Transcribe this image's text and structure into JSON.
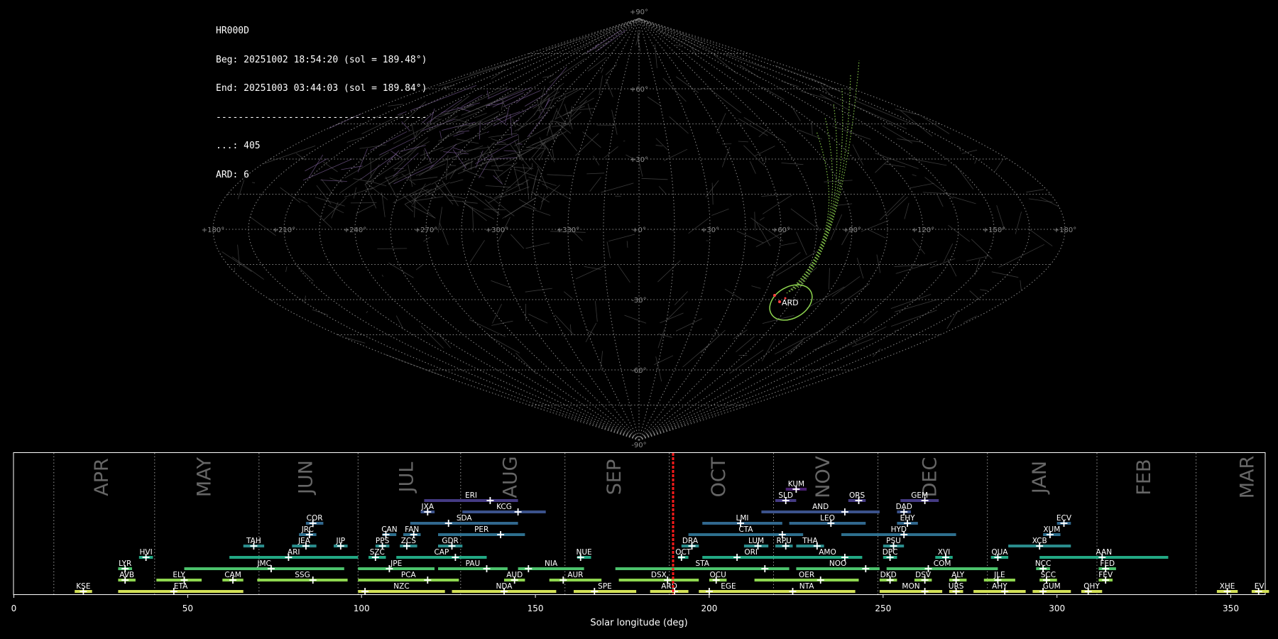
{
  "header": {
    "station": "HR000D",
    "begin": "Beg: 20251002 18:54:20 (sol = 189.48°)",
    "end": "End: 20251003 03:44:03 (sol = 189.84°)",
    "separator": "--------------------------------------",
    "count_line": "...: 405",
    "ard_line": "ARD: 6"
  },
  "chart_data": [
    {
      "type": "scatter",
      "projection": "sinusoidal sky map (radiant positions)",
      "lon_tick_labels": [
        "+180°",
        "+150°",
        "+120°",
        "+90°",
        "+60°",
        "+30°",
        "+0°",
        "+330°",
        "+300°",
        "+270°",
        "+240°",
        "+210°",
        "+180°"
      ],
      "lat_tick_labels": [
        "+90°",
        "+60°",
        "+30°",
        "-30°",
        "-60°",
        "-90°"
      ],
      "highlight": {
        "label": "ARD",
        "color": "#8ed64f"
      },
      "grid": true
    },
    {
      "type": "timeline",
      "xlabel": "Solar longitude (deg)",
      "xlim": [
        0,
        360
      ],
      "x_ticks": [
        0,
        50,
        100,
        150,
        200,
        250,
        300,
        350
      ],
      "current_sol": 189.6,
      "months": [
        {
          "name": "APR",
          "start": 11.5,
          "end": 40.5
        },
        {
          "name": "MAY",
          "start": 40.5,
          "end": 70.5
        },
        {
          "name": "JUN",
          "start": 70.5,
          "end": 99
        },
        {
          "name": "JUL",
          "start": 99,
          "end": 128.5
        },
        {
          "name": "AUG",
          "start": 128.5,
          "end": 158.5
        },
        {
          "name": "SEP",
          "start": 158.5,
          "end": 188.5
        },
        {
          "name": "OCT",
          "start": 188.5,
          "end": 218.5
        },
        {
          "name": "NOV",
          "start": 218.5,
          "end": 248.5
        },
        {
          "name": "DEC",
          "start": 248.5,
          "end": 280
        },
        {
          "name": "JAN",
          "start": 280,
          "end": 311.5
        },
        {
          "name": "FEB",
          "start": 311.5,
          "end": 340
        },
        {
          "name": "MAR",
          "start": 340,
          "end": 371
        }
      ],
      "showers": [
        {
          "code": "KSE",
          "row": 0,
          "start": 17.5,
          "end": 22.5,
          "peak": 20,
          "color": "#d4e157"
        },
        {
          "code": "ETA",
          "row": 0,
          "start": 30,
          "end": 66,
          "peak": 46,
          "color": "#d4e157"
        },
        {
          "code": "NZC",
          "row": 0,
          "start": 99,
          "end": 124,
          "peak": 101,
          "color": "#d4e157"
        },
        {
          "code": "NDA",
          "row": 0,
          "start": 126,
          "end": 156,
          "peak": 141,
          "color": "#d4e157"
        },
        {
          "code": "SPE",
          "row": 0,
          "start": 161,
          "end": 179,
          "peak": 167,
          "color": "#d4e157"
        },
        {
          "code": "ARD",
          "row": 0,
          "start": 183,
          "end": 194,
          "peak": 190,
          "color": "#d4e157"
        },
        {
          "code": "EGE",
          "row": 0,
          "start": 197,
          "end": 214,
          "peak": 200,
          "color": "#d4e157"
        },
        {
          "code": "NTA",
          "row": 0,
          "start": 214,
          "end": 242,
          "peak": 224,
          "color": "#d4e157"
        },
        {
          "code": "MON",
          "row": 0,
          "start": 249,
          "end": 267,
          "peak": 262,
          "color": "#d4e157"
        },
        {
          "code": "URS",
          "row": 0,
          "start": 269,
          "end": 273,
          "peak": 271,
          "color": "#d4e157"
        },
        {
          "code": "AHY",
          "row": 0,
          "start": 276,
          "end": 291,
          "peak": 285,
          "color": "#d4e157"
        },
        {
          "code": "GUM",
          "row": 0,
          "start": 293,
          "end": 304,
          "peak": 296,
          "color": "#d4e157"
        },
        {
          "code": "OHY",
          "row": 0,
          "start": 307,
          "end": 313,
          "peak": 309,
          "color": "#d4e157"
        },
        {
          "code": "XHE",
          "row": 0,
          "start": 346,
          "end": 352,
          "peak": 349,
          "color": "#d4e157"
        },
        {
          "code": "EVI",
          "row": 0,
          "start": 356,
          "end": 361,
          "peak": 358,
          "color": "#d4e157"
        },
        {
          "code": "AVB",
          "row": 1,
          "start": 30,
          "end": 35,
          "peak": 32,
          "color": "#8ed64f"
        },
        {
          "code": "ELY",
          "row": 1,
          "start": 41,
          "end": 54,
          "peak": 49,
          "color": "#8ed64f"
        },
        {
          "code": "CAM",
          "row": 1,
          "start": 60,
          "end": 66,
          "peak": 63,
          "color": "#8ed64f"
        },
        {
          "code": "SSG",
          "row": 1,
          "start": 70,
          "end": 96,
          "peak": 86,
          "color": "#8ed64f"
        },
        {
          "code": "PCA",
          "row": 1,
          "start": 99,
          "end": 128,
          "peak": 119,
          "color": "#8ed64f"
        },
        {
          "code": "AUD",
          "row": 1,
          "start": 141,
          "end": 147,
          "peak": 144,
          "color": "#8ed64f"
        },
        {
          "code": "AUR",
          "row": 1,
          "start": 154,
          "end": 169,
          "peak": 158,
          "color": "#8ed64f"
        },
        {
          "code": "DSX",
          "row": 1,
          "start": 174,
          "end": 197,
          "peak": 188,
          "color": "#8ed64f"
        },
        {
          "code": "OCU",
          "row": 1,
          "start": 200,
          "end": 205,
          "peak": 202,
          "color": "#8ed64f"
        },
        {
          "code": "OER",
          "row": 1,
          "start": 213,
          "end": 243,
          "peak": 232,
          "color": "#8ed64f"
        },
        {
          "code": "DKD",
          "row": 1,
          "start": 249,
          "end": 254,
          "peak": 252,
          "color": "#8ed64f"
        },
        {
          "code": "DSV",
          "row": 1,
          "start": 259,
          "end": 264,
          "peak": 262,
          "color": "#8ed64f"
        },
        {
          "code": "ALY",
          "row": 1,
          "start": 269,
          "end": 274,
          "peak": 271,
          "color": "#8ed64f"
        },
        {
          "code": "JLE",
          "row": 1,
          "start": 279,
          "end": 288,
          "peak": 283,
          "color": "#8ed64f"
        },
        {
          "code": "SCC",
          "row": 1,
          "start": 295,
          "end": 300,
          "peak": 297,
          "color": "#8ed64f"
        },
        {
          "code": "FEV",
          "row": 1,
          "start": 312,
          "end": 316,
          "peak": 314,
          "color": "#8ed64f"
        },
        {
          "code": "LYR",
          "row": 2,
          "start": 30,
          "end": 34,
          "peak": 32,
          "color": "#4cc26c"
        },
        {
          "code": "JMC",
          "row": 2,
          "start": 49,
          "end": 95,
          "peak": 74,
          "color": "#4cc26c"
        },
        {
          "code": "JPE",
          "row": 2,
          "start": 99,
          "end": 121,
          "peak": 108,
          "color": "#4cc26c"
        },
        {
          "code": "PAU",
          "row": 2,
          "start": 122,
          "end": 142,
          "peak": 136,
          "color": "#4cc26c"
        },
        {
          "code": "NIA",
          "row": 2,
          "start": 145,
          "end": 164,
          "peak": 148,
          "color": "#4cc26c"
        },
        {
          "code": "STA",
          "row": 2,
          "start": 173,
          "end": 223,
          "peak": 216,
          "color": "#4cc26c"
        },
        {
          "code": "NOO",
          "row": 2,
          "start": 225,
          "end": 249,
          "peak": 245,
          "color": "#4cc26c"
        },
        {
          "code": "COM",
          "row": 2,
          "start": 251,
          "end": 283,
          "peak": 263,
          "color": "#4cc26c"
        },
        {
          "code": "NCC",
          "row": 2,
          "start": 294,
          "end": 298,
          "peak": 296,
          "color": "#4cc26c"
        },
        {
          "code": "FED",
          "row": 2,
          "start": 312,
          "end": 317,
          "peak": 314,
          "color": "#4cc26c"
        },
        {
          "code": "HVI",
          "row": 3,
          "start": 36,
          "end": 40,
          "peak": 38,
          "color": "#22a884"
        },
        {
          "code": "ARI",
          "row": 3,
          "start": 62,
          "end": 99,
          "peak": 79,
          "color": "#22a884"
        },
        {
          "code": "SZC",
          "row": 3,
          "start": 102,
          "end": 107,
          "peak": 104,
          "color": "#22a884"
        },
        {
          "code": "CAP",
          "row": 3,
          "start": 110,
          "end": 136,
          "peak": 127,
          "color": "#22a884"
        },
        {
          "code": "NUE",
          "row": 3,
          "start": 162,
          "end": 166,
          "peak": 163,
          "color": "#22a884"
        },
        {
          "code": "OCT",
          "row": 3,
          "start": 191,
          "end": 194,
          "peak": 192,
          "color": "#22a884"
        },
        {
          "code": "ORI",
          "row": 3,
          "start": 198,
          "end": 226,
          "peak": 208,
          "color": "#22a884"
        },
        {
          "code": "AMO",
          "row": 3,
          "start": 224,
          "end": 244,
          "peak": 239,
          "color": "#22a884"
        },
        {
          "code": "DPC",
          "row": 3,
          "start": 250,
          "end": 254,
          "peak": 252,
          "color": "#22a884"
        },
        {
          "code": "XVI",
          "row": 3,
          "start": 265,
          "end": 270,
          "peak": 268,
          "color": "#22a884"
        },
        {
          "code": "QUA",
          "row": 3,
          "start": 281,
          "end": 286,
          "peak": 283,
          "color": "#22a884"
        },
        {
          "code": "AAN",
          "row": 3,
          "start": 295,
          "end": 332,
          "peak": 313,
          "color": "#22a884"
        },
        {
          "code": "TAH",
          "row": 4,
          "start": 66,
          "end": 72,
          "peak": 69,
          "color": "#2a8c8c"
        },
        {
          "code": "JEA",
          "row": 4,
          "start": 80,
          "end": 87,
          "peak": 84,
          "color": "#2a8c8c"
        },
        {
          "code": "JIP",
          "row": 4,
          "start": 92,
          "end": 96,
          "peak": 94,
          "color": "#2a8c8c"
        },
        {
          "code": "PPS",
          "row": 4,
          "start": 104,
          "end": 108,
          "peak": 106,
          "color": "#2a8c8c"
        },
        {
          "code": "ZCS",
          "row": 4,
          "start": 111,
          "end": 116,
          "peak": 113,
          "color": "#2a8c8c"
        },
        {
          "code": "GDR",
          "row": 4,
          "start": 122,
          "end": 129,
          "peak": 126,
          "color": "#2a8c8c"
        },
        {
          "code": "DRA",
          "row": 4,
          "start": 192,
          "end": 197,
          "peak": 195,
          "color": "#2a8c8c"
        },
        {
          "code": "LUM",
          "row": 4,
          "start": 210,
          "end": 217,
          "peak": 214,
          "color": "#2a8c8c"
        },
        {
          "code": "RPU",
          "row": 4,
          "start": 219,
          "end": 224,
          "peak": 222,
          "color": "#2a8c8c"
        },
        {
          "code": "THA",
          "row": 4,
          "start": 225,
          "end": 233,
          "peak": 231,
          "color": "#2a8c8c"
        },
        {
          "code": "PSU",
          "row": 4,
          "start": 250,
          "end": 256,
          "peak": 253,
          "color": "#2a8c8c"
        },
        {
          "code": "XCB",
          "row": 4,
          "start": 286,
          "end": 304,
          "peak": 295,
          "color": "#2a8c8c"
        },
        {
          "code": "JRC",
          "row": 5,
          "start": 82,
          "end": 87,
          "peak": 85,
          "color": "#2e6f8e"
        },
        {
          "code": "CAN",
          "row": 5,
          "start": 106,
          "end": 110,
          "peak": 107,
          "color": "#2e6f8e"
        },
        {
          "code": "FAN",
          "row": 5,
          "start": 112,
          "end": 117,
          "peak": 115,
          "color": "#2e6f8e"
        },
        {
          "code": "PER",
          "row": 5,
          "start": 122,
          "end": 147,
          "peak": 140,
          "color": "#2e6f8e"
        },
        {
          "code": "CTA",
          "row": 5,
          "start": 194,
          "end": 227,
          "peak": 221,
          "color": "#2e6f8e"
        },
        {
          "code": "HYD",
          "row": 5,
          "start": 238,
          "end": 271,
          "peak": 256,
          "color": "#2e6f8e"
        },
        {
          "code": "XUM",
          "row": 5,
          "start": 296,
          "end": 301,
          "peak": 298,
          "color": "#2e6f8e"
        },
        {
          "code": "COR",
          "row": 6,
          "start": 84,
          "end": 89,
          "peak": 86,
          "color": "#31688e"
        },
        {
          "code": "SDA",
          "row": 6,
          "start": 114,
          "end": 145,
          "peak": 125,
          "color": "#31688e"
        },
        {
          "code": "LMI",
          "row": 6,
          "start": 198,
          "end": 221,
          "peak": 209,
          "color": "#31688e"
        },
        {
          "code": "LEO",
          "row": 6,
          "start": 223,
          "end": 245,
          "peak": 235,
          "color": "#31688e"
        },
        {
          "code": "EHY",
          "row": 6,
          "start": 254,
          "end": 260,
          "peak": 257,
          "color": "#31688e"
        },
        {
          "code": "ECV",
          "row": 6,
          "start": 300,
          "end": 304,
          "peak": 302,
          "color": "#31688e"
        },
        {
          "code": "JXA",
          "row": 7,
          "start": 117,
          "end": 121,
          "peak": 119,
          "color": "#3b528b"
        },
        {
          "code": "KCG",
          "row": 7,
          "start": 129,
          "end": 153,
          "peak": 145,
          "color": "#3b528b"
        },
        {
          "code": "AND",
          "row": 7,
          "start": 215,
          "end": 249,
          "peak": 239,
          "color": "#3b528b"
        },
        {
          "code": "DAD",
          "row": 7,
          "start": 254,
          "end": 258,
          "peak": 256,
          "color": "#3b528b"
        },
        {
          "code": "ERI",
          "row": 8,
          "start": 118,
          "end": 145,
          "peak": 137,
          "color": "#443a83"
        },
        {
          "code": "SLD",
          "row": 8,
          "start": 219,
          "end": 225,
          "peak": 222,
          "color": "#443a83"
        },
        {
          "code": "ORS",
          "row": 8,
          "start": 240,
          "end": 245,
          "peak": 243,
          "color": "#443a83"
        },
        {
          "code": "GEM",
          "row": 8,
          "start": 255,
          "end": 266,
          "peak": 262,
          "color": "#443a83"
        },
        {
          "code": "KUM",
          "row": 9,
          "start": 222,
          "end": 228,
          "peak": 225,
          "color": "#481f70"
        }
      ]
    }
  ]
}
